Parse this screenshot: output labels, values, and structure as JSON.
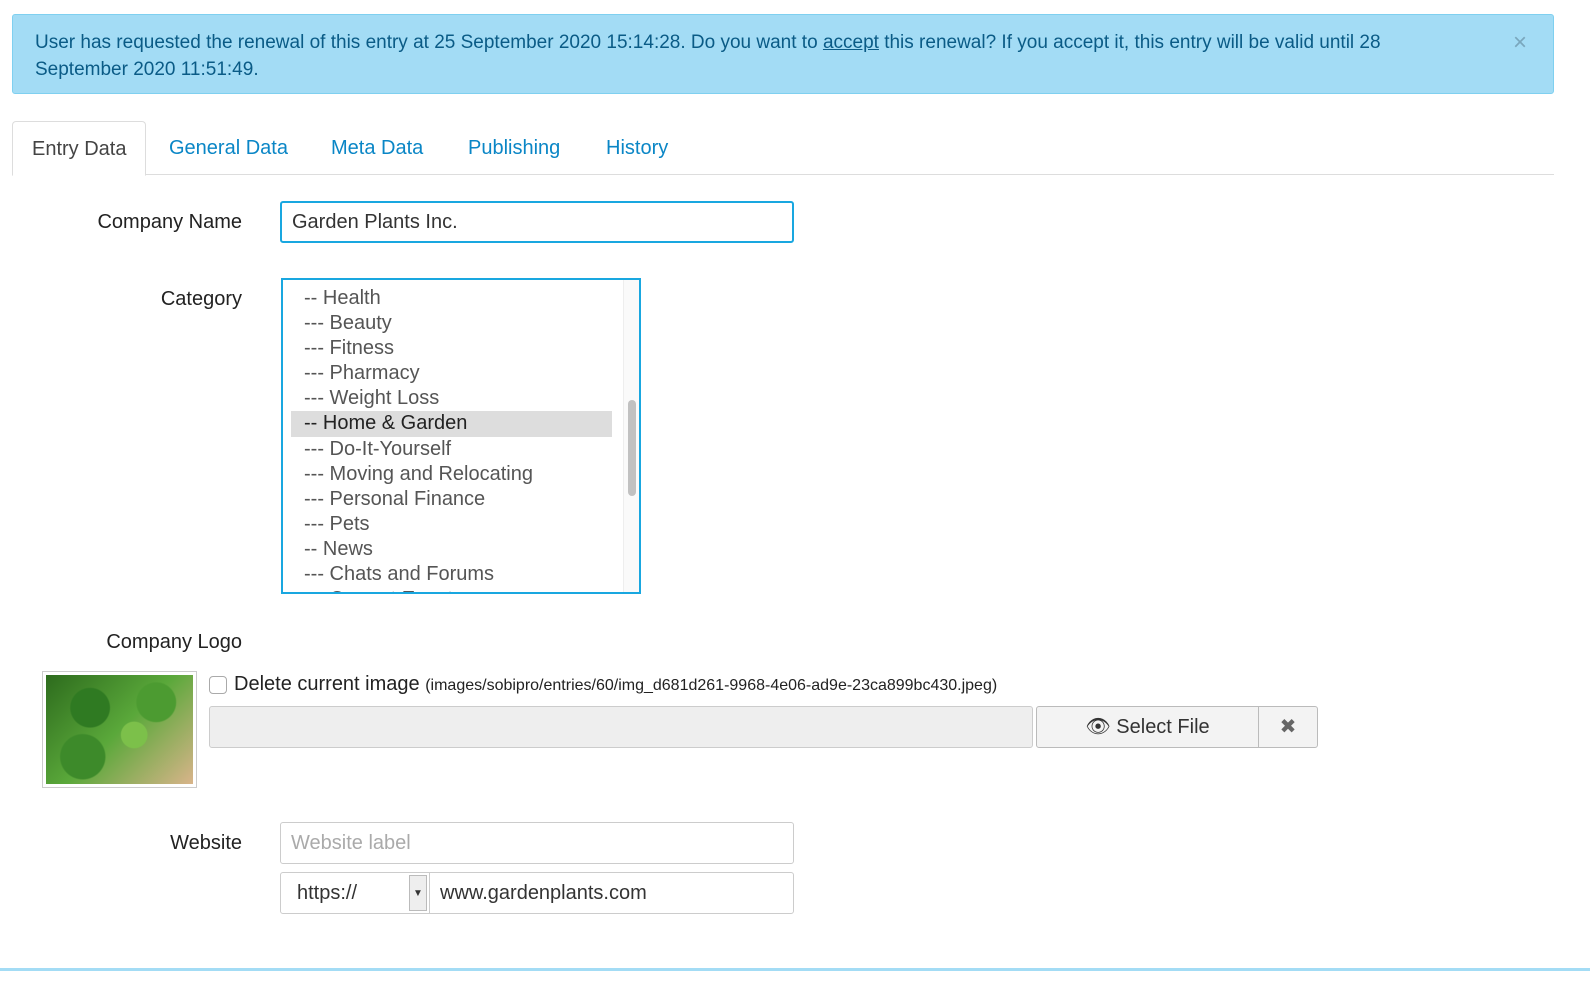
{
  "alert": {
    "text_before": "User has requested the renewal of this entry at 25 September 2020 15:14:28. Do you want to ",
    "link": "accept",
    "text_after": " this renewal? If you accept it, this entry will be valid until 28 September 2020 11:51:49.",
    "close": "×"
  },
  "tabs": [
    "Entry Data",
    "General Data",
    "Meta Data",
    "Publishing",
    "History"
  ],
  "form": {
    "company_name": {
      "label": "Company Name",
      "value": "Garden Plants Inc."
    },
    "category": {
      "label": "Category",
      "options": [
        "-- Health",
        "--- Beauty",
        "--- Fitness",
        "--- Pharmacy",
        "--- Weight Loss",
        "-- Home & Garden",
        "--- Do-It-Yourself",
        "--- Moving and Relocating",
        "--- Personal Finance",
        "--- Pets",
        "-- News",
        "--- Chats and Forums",
        "--- Current Events"
      ],
      "selected": "-- Home & Garden"
    },
    "logo": {
      "label": "Company Logo",
      "delete_label": "Delete current image",
      "path": "(images/sobipro/entries/60/img_d681d261-9968-4e06-ad9e-23ca899bc430.jpeg)",
      "select_file": "Select File",
      "clear": "✖"
    },
    "website": {
      "label": "Website",
      "label_placeholder": "Website label",
      "protocol": "https://",
      "url": "www.gardenplants.com"
    }
  }
}
